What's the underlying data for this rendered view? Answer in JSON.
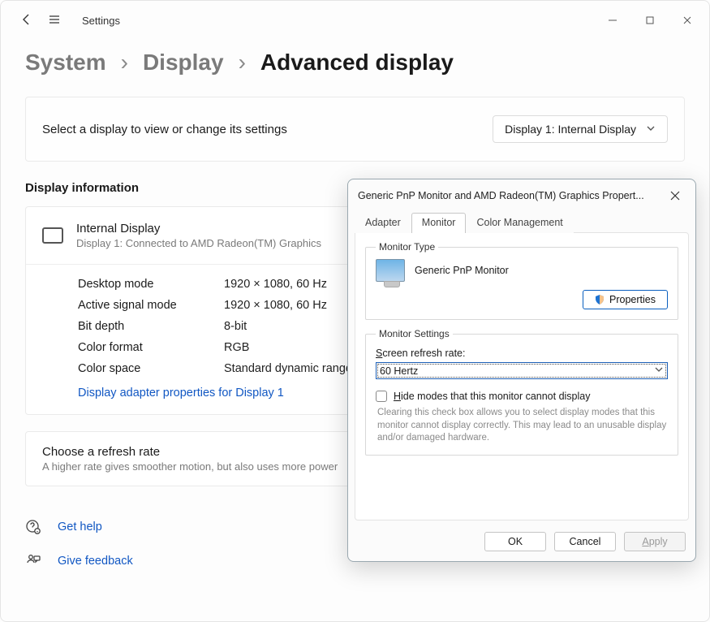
{
  "titlebar": {
    "app_title": "Settings"
  },
  "breadcrumb": {
    "a": "System",
    "b": "Display",
    "c": "Advanced display"
  },
  "select_panel": {
    "msg": "Select a display to view or change its settings",
    "dropdown": "Display 1: Internal Display"
  },
  "display_info": {
    "section_title": "Display information",
    "name": "Internal Display",
    "sub": "Display 1: Connected to AMD Radeon(TM) Graphics",
    "rows": {
      "desktop_mode_k": "Desktop mode",
      "desktop_mode_v": "1920 × 1080, 60 Hz",
      "active_signal_k": "Active signal mode",
      "active_signal_v": "1920 × 1080, 60 Hz",
      "bit_depth_k": "Bit depth",
      "bit_depth_v": "8-bit",
      "color_format_k": "Color format",
      "color_format_v": "RGB",
      "color_space_k": "Color space",
      "color_space_v": "Standard dynamic range (SDR)"
    },
    "adapter_link": "Display adapter properties for Display 1"
  },
  "refresh_rate_card": {
    "title": "Choose a refresh rate",
    "sub": "A higher rate gives smoother motion, but also uses more power"
  },
  "help": {
    "get_help": "Get help",
    "give_feedback": "Give feedback"
  },
  "dialog": {
    "title": "Generic PnP Monitor and AMD Radeon(TM) Graphics Propert...",
    "tabs": {
      "adapter": "Adapter",
      "monitor": "Monitor",
      "color_mgmt": "Color Management"
    },
    "monitor_type_legend": "Monitor Type",
    "monitor_name": "Generic PnP Monitor",
    "properties_btn": "Properties",
    "monitor_settings_legend": "Monitor Settings",
    "refresh_label_pre": "S",
    "refresh_label_post": "creen refresh rate:",
    "refresh_value": "60 Hertz",
    "hide_modes_pre": "H",
    "hide_modes_post": "ide modes that this monitor cannot display",
    "hint": "Clearing this check box allows you to select display modes that this monitor cannot display correctly. This may lead to an unusable display and/or damaged hardware.",
    "ok": "OK",
    "cancel": "Cancel",
    "apply_pre": "A",
    "apply_post": "pply"
  }
}
